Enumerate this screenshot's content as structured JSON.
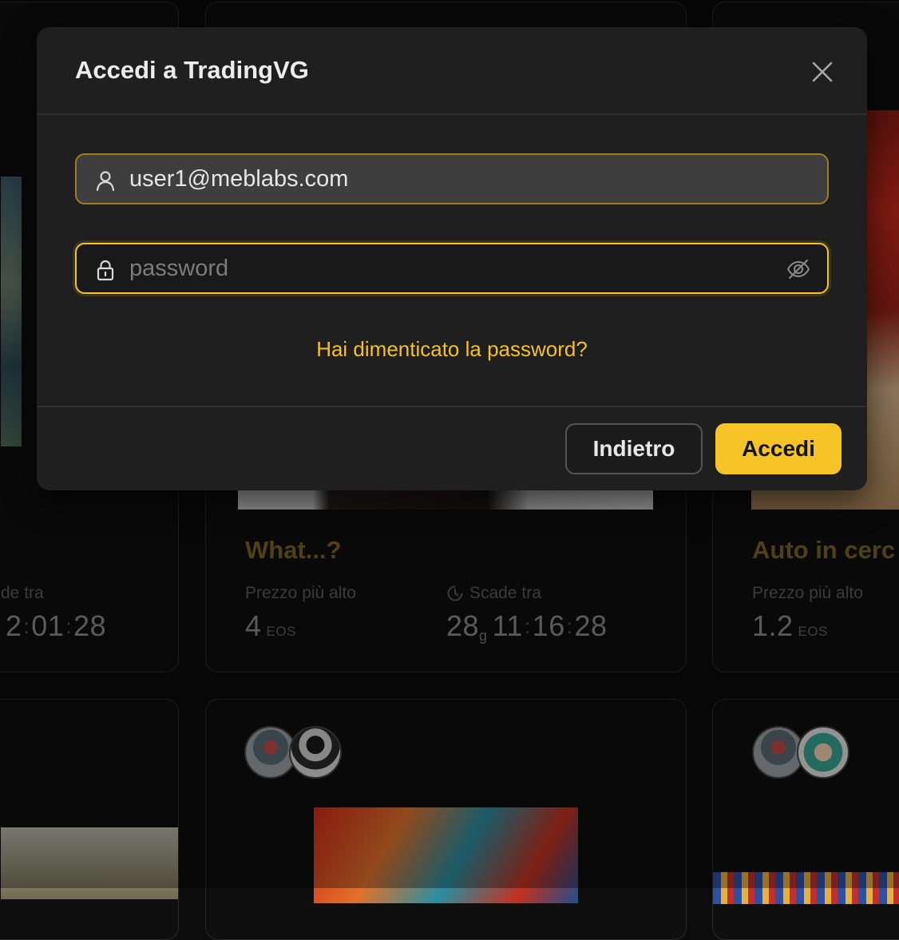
{
  "modal": {
    "title": "Accedi a TradingVG",
    "email_value": "user1@meblabs.com",
    "password_placeholder": "password",
    "forgot_link": "Hai dimenticato la password?",
    "back_button": "Indietro",
    "login_button": "Accedi"
  },
  "cards": {
    "left_label": "de tra",
    "left_time": {
      "h": "2",
      "m": "01",
      "s": "28"
    },
    "middle": {
      "title": "What...?",
      "price_label": "Prezzo più alto",
      "price_value": "4",
      "price_unit": "EOS",
      "expiry_label": "Scade tra",
      "expiry_days": "28",
      "days_suffix": "g",
      "expiry_h": "11",
      "expiry_m": "16",
      "expiry_s": "28"
    },
    "right": {
      "title": "Auto in cerc",
      "price_label": "Prezzo più alto",
      "price_value": "1.2",
      "price_unit": "EOS"
    }
  },
  "colors": {
    "accent": "#f7c427",
    "link": "#f5c02e",
    "modal_bg": "#1f1f1f",
    "page_bg": "#0c0c0c"
  },
  "icons": [
    "user-icon",
    "lock-icon",
    "eye-off-icon",
    "close-icon",
    "clock-icon"
  ]
}
